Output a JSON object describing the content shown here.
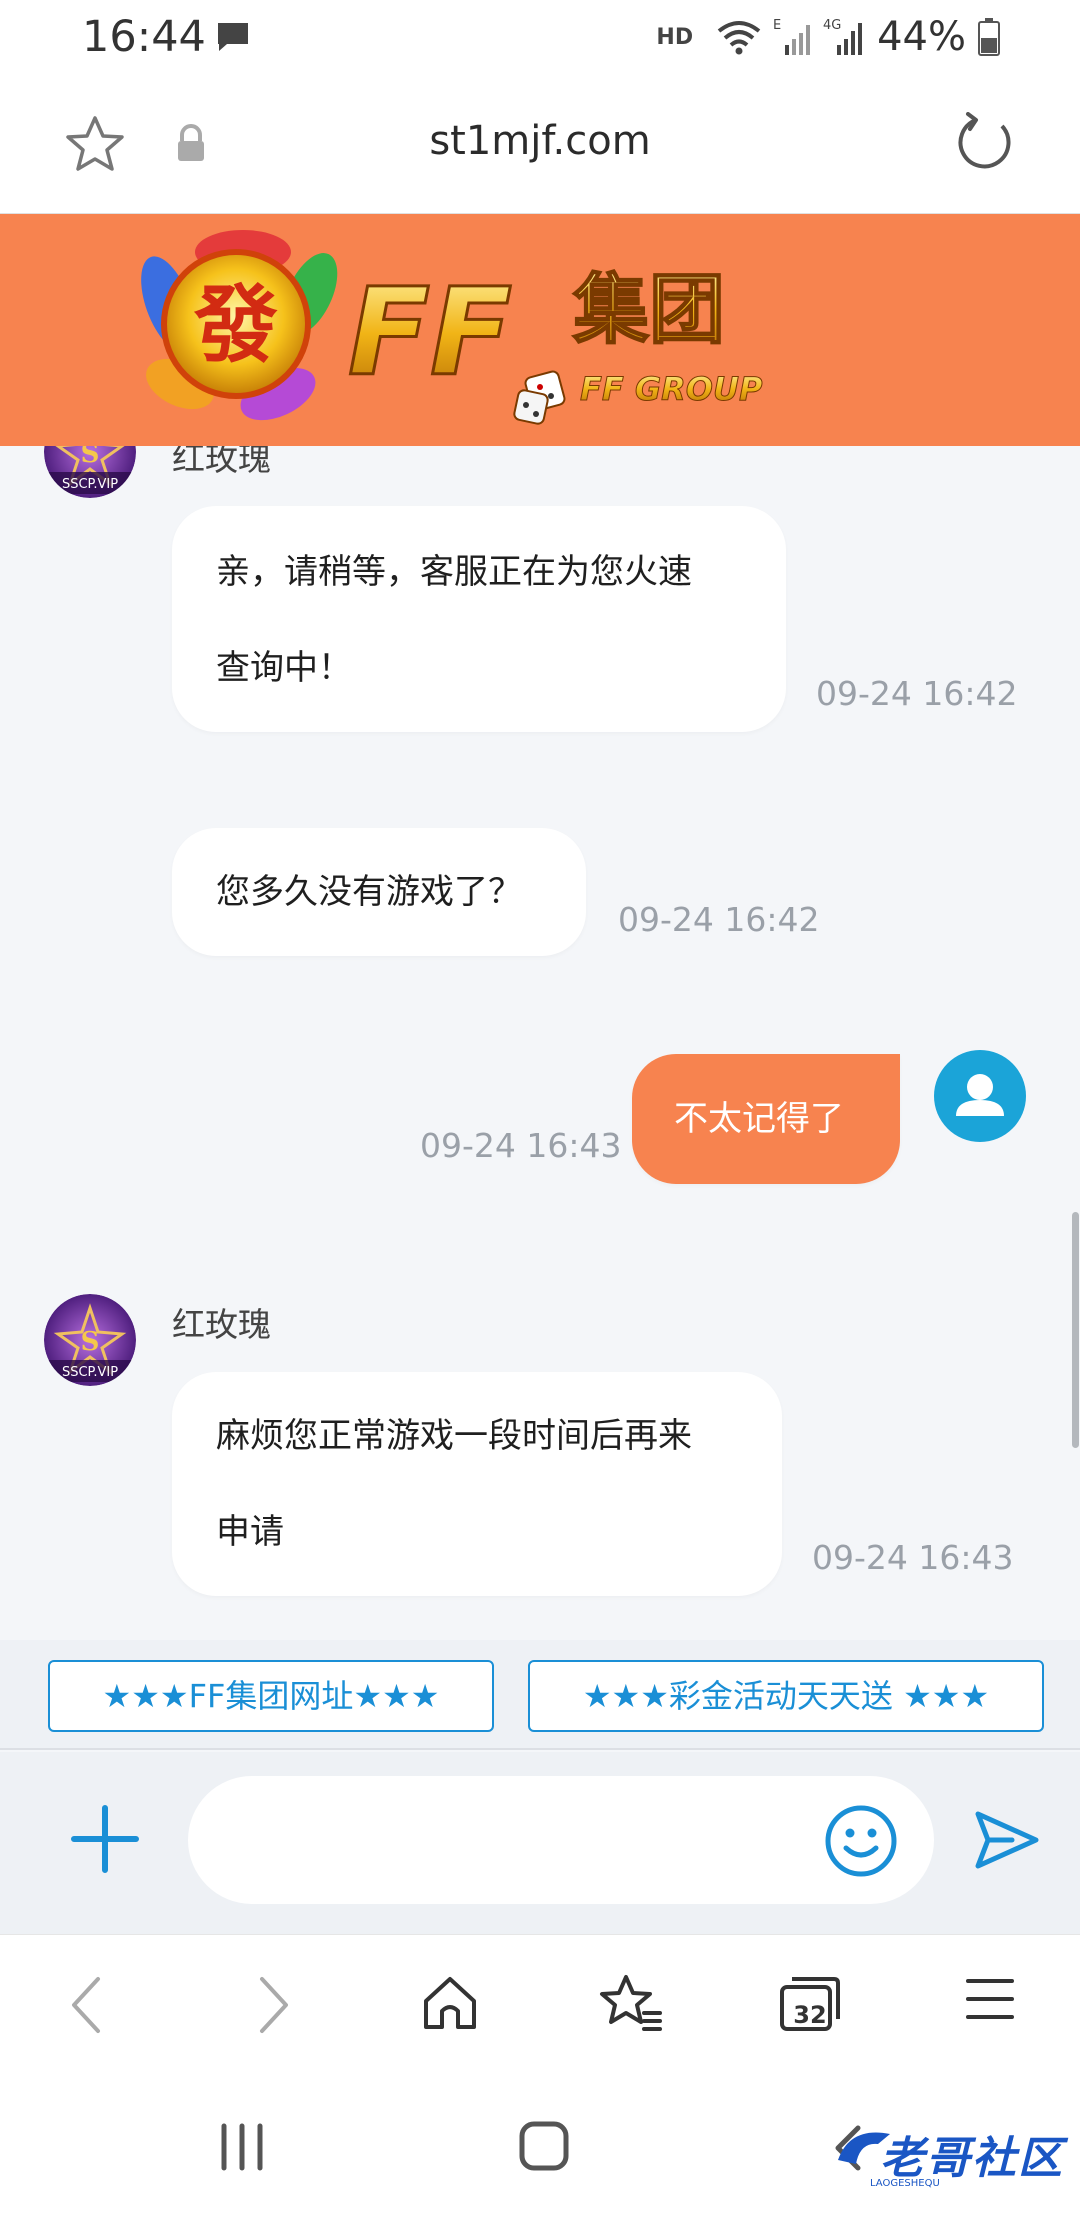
{
  "status_bar": {
    "time": "16:44",
    "hd_label": "HD",
    "battery_percent": "44%",
    "icons": [
      "message-icon",
      "wifi-icon",
      "signal-e-icon",
      "signal-4g-icon",
      "battery-icon"
    ]
  },
  "browser": {
    "url": "st1mjf.com",
    "tab_count": "32"
  },
  "banner": {
    "logo_char": "發",
    "brand_main": "FF集团",
    "brand_sub": "FF GROUP",
    "background_color": "#f7834f"
  },
  "chat": {
    "messages": [
      {
        "direction": "incoming",
        "sender": "红玫瑰",
        "lines": [
          "亲，请稍等，客服正在为您火速",
          "查询中！"
        ],
        "time": "09-24 16:42"
      },
      {
        "direction": "incoming",
        "lines": [
          "您多久没有游戏了？"
        ],
        "time": "09-24 16:42"
      },
      {
        "direction": "outgoing",
        "lines": [
          "不太记得了"
        ],
        "time": "09-24 16:43"
      },
      {
        "direction": "incoming",
        "sender": "红玫瑰",
        "lines": [
          "麻烦您正常游戏一段时间后再来",
          "申请"
        ],
        "time": "09-24 16:43"
      }
    ],
    "avatar_text": "SSCP.VIP",
    "avatar_monogram": "S"
  },
  "quick_links": [
    {
      "label": "★★★FF集团网址★★★"
    },
    {
      "label": "★★★彩金活动天天送 ★★★"
    }
  ],
  "input": {
    "placeholder": "",
    "value": ""
  },
  "watermark": {
    "text": "老哥社区",
    "sub": "LAOGESHEQU"
  },
  "colors": {
    "accent": "#f7834f",
    "link": "#1a8fd6",
    "user_avatar": "#1ba4d8"
  }
}
